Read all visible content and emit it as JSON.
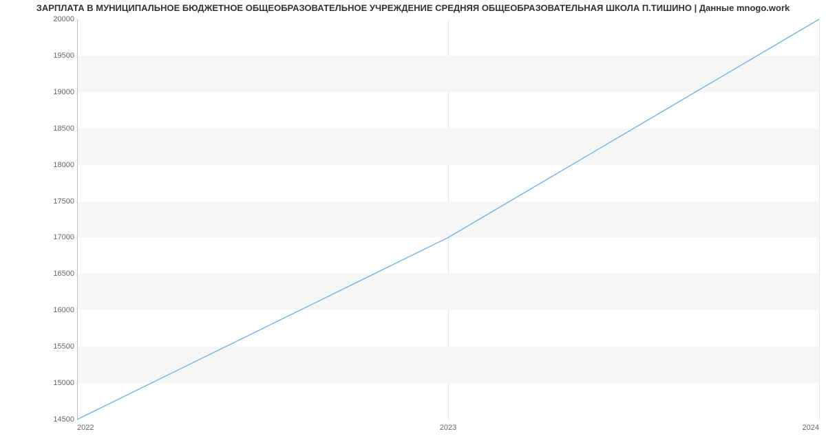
{
  "chart_data": {
    "type": "line",
    "title": "ЗАРПЛАТА В МУНИЦИПАЛЬНОЕ БЮДЖЕТНОЕ ОБЩЕОБРАЗОВАТЕЛЬНОЕ УЧРЕЖДЕНИЕ СРЕДНЯЯ ОБЩЕОБРАЗОВАТЕЛЬНАЯ ШКОЛА П.ТИШИНО | Данные mnogo.work",
    "xlabel": "",
    "ylabel": "",
    "x": [
      2022,
      2023,
      2024
    ],
    "values": [
      14500,
      17000,
      20000
    ],
    "x_ticks": [
      "2022",
      "2023",
      "2024"
    ],
    "y_ticks": [
      14500,
      15000,
      15500,
      16000,
      16500,
      17000,
      17500,
      18000,
      18500,
      19000,
      19500,
      20000
    ],
    "ylim": [
      14500,
      20000
    ],
    "xlim": [
      2022,
      2024
    ],
    "line_color": "#7cb5ec",
    "band_color": "#f6f6f6"
  }
}
